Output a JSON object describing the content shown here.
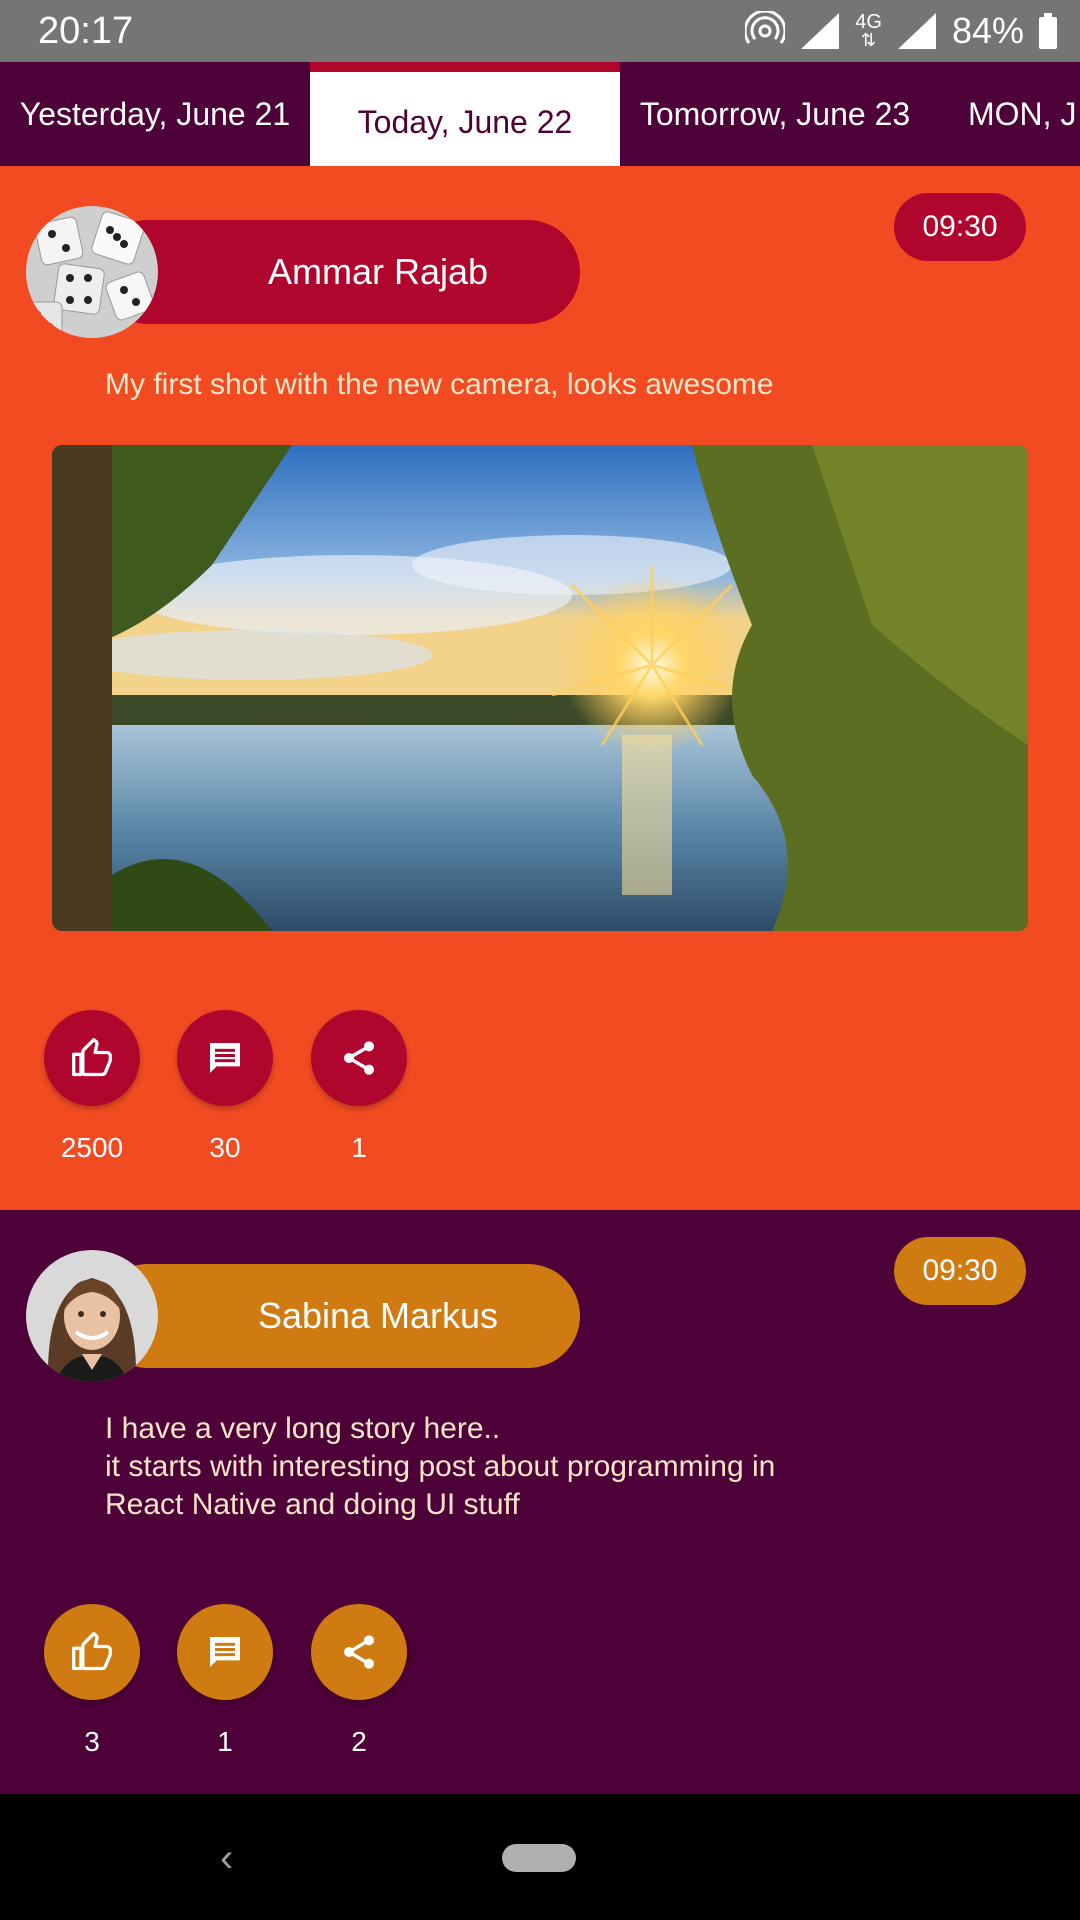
{
  "status_bar": {
    "time": "20:17",
    "network": "4G",
    "battery": "84%"
  },
  "tabs": [
    {
      "label": "Yesterday, June 21",
      "active": false
    },
    {
      "label": "Today, June 22",
      "active": true
    },
    {
      "label": "Tomorrow, June 23",
      "active": false
    },
    {
      "label": "MON, J",
      "active": false
    }
  ],
  "posts": [
    {
      "author": "Ammar Rajab",
      "time": "09:30",
      "text": "My first shot with the new camera, looks awesome",
      "likes": "2500",
      "comments": "30",
      "shares": "1",
      "colors": {
        "background": "#f24b22",
        "accent": "#b0062e"
      }
    },
    {
      "author": "Sabina Markus",
      "time": "09:30",
      "text_lines": [
        "I have a very long story here..",
        "it starts with interesting post about programming in",
        "React Native and doing UI stuff"
      ],
      "likes": "3",
      "comments": "1",
      "shares": "2",
      "colors": {
        "background": "#4e0038",
        "accent": "#d07a12"
      }
    }
  ],
  "icons": [
    "wifi-hotspot-icon",
    "signal-icon",
    "battery-icon",
    "thumbs-up-icon",
    "comment-icon",
    "share-icon",
    "back-icon",
    "home-icon"
  ]
}
